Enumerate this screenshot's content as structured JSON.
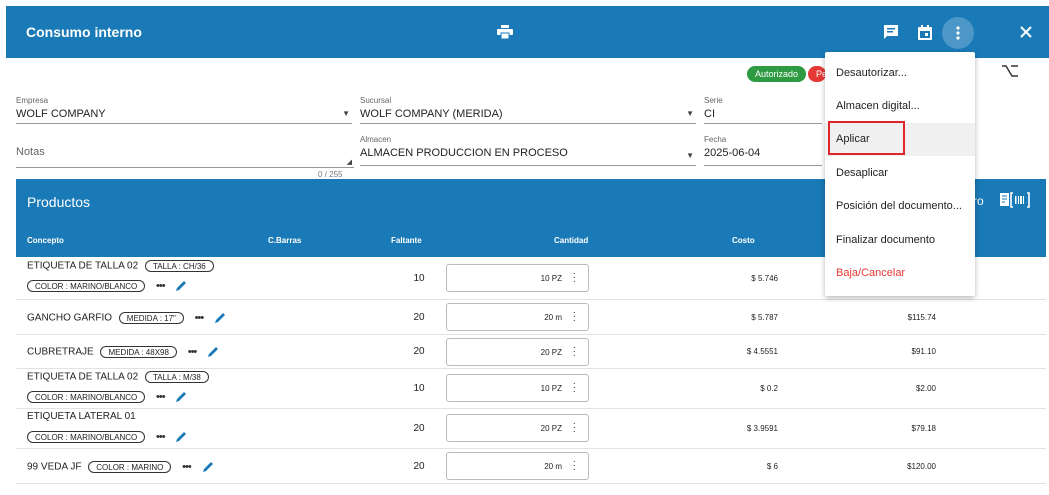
{
  "header": {
    "title": "Consumo interno",
    "icons": [
      "printer-icon",
      "comment-icon",
      "calendar-icon",
      "more-vert-icon",
      "close-icon"
    ]
  },
  "status": {
    "autorizado": "Autorizado",
    "pendiente": "Pe"
  },
  "form": {
    "empresa": {
      "label": "Empresa",
      "value": "WOLF COMPANY"
    },
    "sucursal": {
      "label": "Sucursal",
      "value": "WOLF COMPANY (MERIDA)"
    },
    "serie": {
      "label": "Serie",
      "value": "CI"
    },
    "notas": {
      "placeholder": "Notas",
      "counter": "0 / 255"
    },
    "almacen": {
      "label": "Almacen",
      "value": "ALMACEN PRODUCCION EN PROCESO"
    },
    "fecha": {
      "label": "Fecha",
      "value": "2025-06-04"
    }
  },
  "products": {
    "title": "Productos",
    "right_text": "ro",
    "columns": {
      "concepto": "Concepto",
      "barras": "C.Barras",
      "faltante": "Faltante",
      "cantidad": "Cantidad",
      "costo": "Costo"
    },
    "rows": [
      {
        "name": "ETIQUETA DE TALLA 02",
        "chips_line1": [
          "TALLA : CH/36"
        ],
        "chips_line2": [
          "COLOR : MARINO/BLANCO"
        ],
        "faltante": "10",
        "cantidad": "10 PZ",
        "costo": "$ 5.746",
        "total": ""
      },
      {
        "name": "GANCHO GARFIO",
        "chips_line1": [
          "MEDIDA : 17\""
        ],
        "chips_line2": [],
        "faltante": "20",
        "cantidad": "20 m",
        "costo": "$ 5.787",
        "total": "$115.74"
      },
      {
        "name": "CUBRETRAJE",
        "chips_line1": [
          "MEDIDA : 48X98"
        ],
        "chips_line2": [],
        "faltante": "20",
        "cantidad": "20 PZ",
        "costo": "$ 4.5551",
        "total": "$91.10"
      },
      {
        "name": "ETIQUETA DE TALLA 02",
        "chips_line1": [
          "TALLA : M/38"
        ],
        "chips_line2": [
          "COLOR : MARINO/BLANCO"
        ],
        "faltante": "10",
        "cantidad": "10 PZ",
        "costo": "$ 0.2",
        "total": "$2.00"
      },
      {
        "name": "ETIQUETA LATERAL 01",
        "chips_line1": [],
        "chips_line2": [
          "COLOR : MARINO/BLANCO"
        ],
        "faltante": "20",
        "cantidad": "20 PZ",
        "costo": "$ 3.9591",
        "total": "$79.18"
      },
      {
        "name": "99 VEDA JF",
        "chips_line1": [
          "COLOR : MARINO"
        ],
        "chips_line2": [],
        "faltante": "20",
        "cantidad": "20 m",
        "costo": "$ 6",
        "total": "$120.00"
      }
    ]
  },
  "menu": {
    "items": [
      "Desautorizar...",
      "Almacen digital...",
      "Aplicar",
      "Desaplicar",
      "Posición del documento...",
      "Finalizar documento",
      "Baja/Cancelar"
    ]
  }
}
